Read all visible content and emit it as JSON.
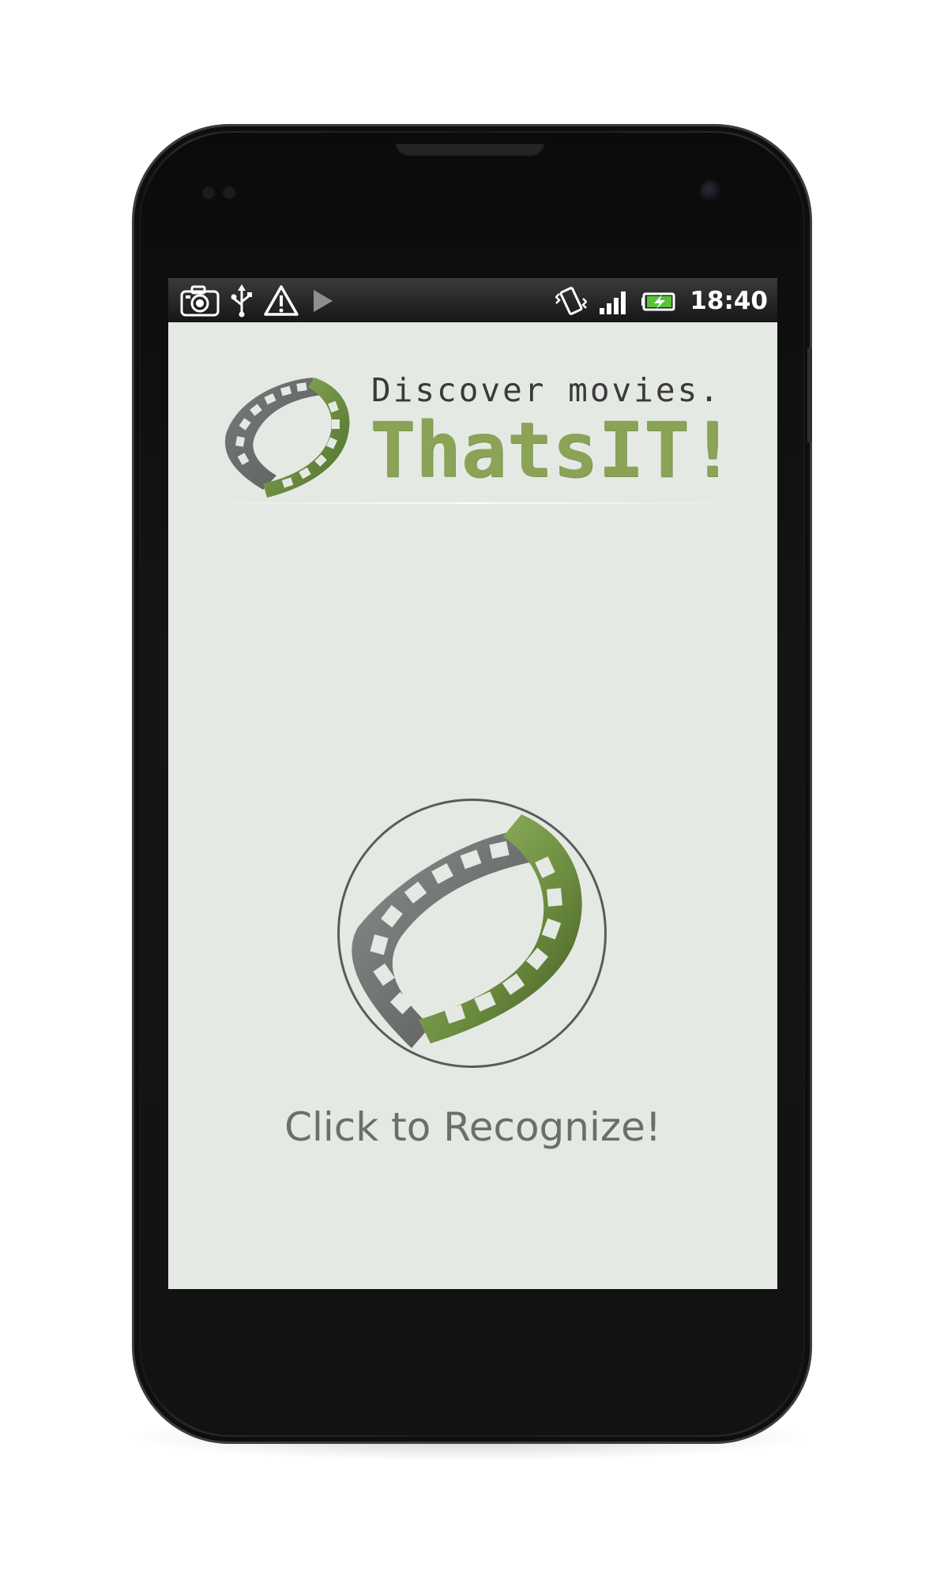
{
  "status_bar": {
    "left_icons": [
      "camera-icon",
      "usb-icon",
      "warning-icon",
      "play-store-icon"
    ],
    "right_icons": [
      "vibrate-icon",
      "signal-icon",
      "battery-charging-icon"
    ],
    "time": "18:40"
  },
  "header": {
    "tagline": "Discover movies.",
    "brand": "ThatsIT!",
    "logo_icon": "film-reel-icon"
  },
  "main": {
    "recognize_icon": "film-reel-icon",
    "recognize_label": "Click to Recognize!"
  },
  "colors": {
    "screen_background": "#e5e9e4",
    "brand_green": "#8aa356",
    "film_gray": "#6f7271",
    "film_green": "#5f7e38",
    "label_gray": "#6b6e6b"
  }
}
